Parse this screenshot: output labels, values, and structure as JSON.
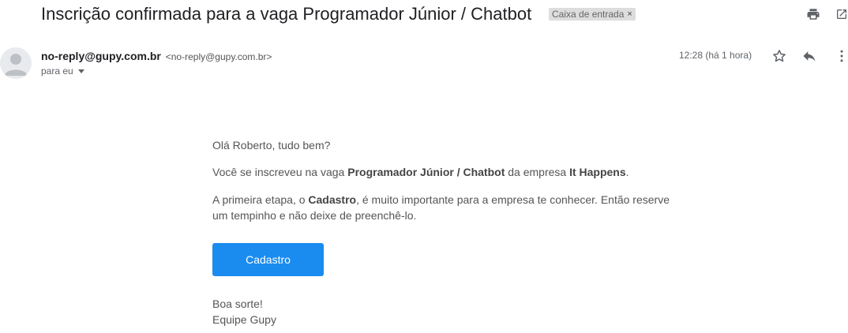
{
  "email": {
    "subject": "Inscrição confirmada para a vaga Programador Júnior / Chatbot",
    "label": "Caixa de entrada",
    "label_remove": "×",
    "sender_name": "no-reply@gupy.com.br",
    "sender_email": "<no-reply@gupy.com.br>",
    "to": "para eu",
    "time": "12:28 (há 1 hora)"
  },
  "body": {
    "greeting": "Olá Roberto, tudo bem?",
    "line1_pre": "Você se inscreveu na vaga ",
    "job": "Programador Júnior / Chatbot",
    "line1_mid": " da empresa ",
    "company": "It Happens",
    "line1_end": ".",
    "line2_pre": "A primeira etapa, o ",
    "step": "Cadastro",
    "line2_post": ", é muito importante para a empresa te conhecer. Então reserve um tempinho e não deixe de preenchê-lo.",
    "button": "Cadastro",
    "closing": "Boa sorte!",
    "signature": "Equipe Gupy"
  },
  "icons": {
    "print": "printer-icon",
    "popout": "open-in-new-window-icon",
    "star": "star-icon",
    "reply": "reply-icon",
    "more": "more-vertical-icon"
  },
  "colors": {
    "button": "#1a8cf0",
    "chip": "#dddddd"
  }
}
